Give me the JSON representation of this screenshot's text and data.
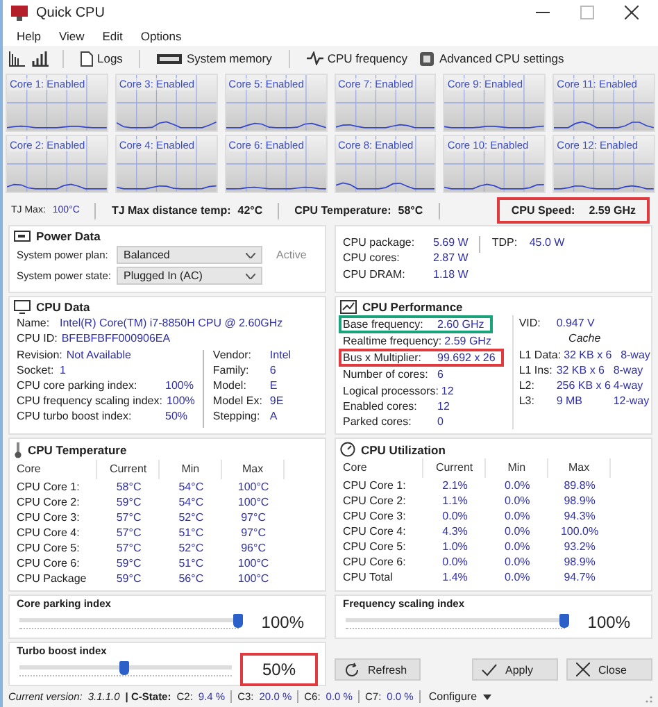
{
  "window": {
    "title": "Quick CPU"
  },
  "menu": [
    "Help",
    "View",
    "Edit",
    "Options"
  ],
  "toolbar": [
    "Logs",
    "System memory",
    "CPU frequency",
    "Advanced CPU settings"
  ],
  "cores": [
    {
      "label": "Core 1: Enabled"
    },
    {
      "label": "Core 3: Enabled"
    },
    {
      "label": "Core 5: Enabled"
    },
    {
      "label": "Core 7: Enabled"
    },
    {
      "label": "Core 9: Enabled"
    },
    {
      "label": "Core 11: Enabled"
    },
    {
      "label": "Core 2: Enabled"
    },
    {
      "label": "Core 4: Enabled"
    },
    {
      "label": "Core 6: Enabled"
    },
    {
      "label": "Core 8: Enabled"
    },
    {
      "label": "Core 10: Enabled"
    },
    {
      "label": "Core 12: Enabled"
    }
  ],
  "summary": {
    "tj_max_label": "TJ Max:",
    "tj_max": "100°C",
    "distance_label": "TJ Max distance temp:",
    "distance": "42°C",
    "temp_label": "CPU Temperature:",
    "temp": "58°C",
    "speed_label": "CPU Speed:",
    "speed": "2.59 GHz",
    "speed_highlighted": true
  },
  "power_data": {
    "title": "Power Data",
    "plan_label": "System power plan:",
    "plan": "Balanced",
    "plan_status": "Active",
    "state_label": "System power state:",
    "state": "Plugged In (AC)"
  },
  "power_readings": {
    "rows": [
      {
        "label": "CPU package:",
        "value": "5.69 W"
      },
      {
        "label": "CPU cores:",
        "value": "2.87 W"
      },
      {
        "label": "CPU DRAM:",
        "value": "1.18 W"
      }
    ],
    "tdp_label": "TDP:",
    "tdp": "45.0 W"
  },
  "cpu_data": {
    "title": "CPU Data",
    "name_label": "Name:",
    "name": "Intel(R) Core(TM) i7-8850H CPU @ 2.60GHz",
    "id_label": "CPU ID:",
    "id": "BFEBFBFF000906EA",
    "left": [
      {
        "label": "Revision:",
        "value": "Not Available"
      },
      {
        "label": "Socket:",
        "value": "1"
      },
      {
        "label": "CPU core parking index:",
        "value": "100%"
      },
      {
        "label": "CPU frequency scaling index:",
        "value": "100%"
      },
      {
        "label": "CPU turbo boost index:",
        "value": "50%"
      }
    ],
    "right": [
      {
        "label": "Vendor:",
        "value": "Intel"
      },
      {
        "label": "Family:",
        "value": "6"
      },
      {
        "label": "Model:",
        "value": "E"
      },
      {
        "label": "Model Ex:",
        "value": "9E"
      },
      {
        "label": "Stepping:",
        "value": "A"
      }
    ]
  },
  "cpu_performance": {
    "title": "CPU Performance",
    "rows": [
      {
        "label": "Base frequency:",
        "value": "2.60 GHz",
        "highlighted": true,
        "color": "#1aa37a"
      },
      {
        "label": "Realtime frequency:",
        "value": "2.59 GHz"
      },
      {
        "label": "Bus x Multiplier:",
        "value": "99.692 x 26",
        "highlighted": true,
        "color": "#e0393e"
      },
      {
        "label": "Number of cores:",
        "value": "6"
      },
      {
        "label": "Logical processors:",
        "value": "12"
      },
      {
        "label": "Enabled cores:",
        "value": "12"
      },
      {
        "label": "Parked cores:",
        "value": "0"
      }
    ],
    "vid_label": "VID:",
    "vid": "0.947 V",
    "cache_title": "Cache",
    "cache": [
      {
        "label": "L1 Data:",
        "size": "32 KB x 6",
        "ways": "8-way"
      },
      {
        "label": "L1 Ins:",
        "size": "32 KB x 6",
        "ways": "8-way"
      },
      {
        "label": "L2:",
        "size": "256 KB x 6",
        "ways": "4-way"
      },
      {
        "label": "L3:",
        "size": "9 MB",
        "ways": "12-way"
      }
    ]
  },
  "tables": [
    {
      "kind": "temperature",
      "title": "CPU Temperature",
      "columns": [
        "Core",
        "Current",
        "Min",
        "Max"
      ],
      "rows": [
        [
          "CPU Core 1:",
          "58°C",
          "54°C",
          "100°C"
        ],
        [
          "CPU Core 2:",
          "59°C",
          "54°C",
          "100°C"
        ],
        [
          "CPU Core 3:",
          "57°C",
          "52°C",
          "97°C"
        ],
        [
          "CPU Core 4:",
          "57°C",
          "51°C",
          "97°C"
        ],
        [
          "CPU Core 5:",
          "57°C",
          "52°C",
          "96°C"
        ],
        [
          "CPU Core 6:",
          "59°C",
          "51°C",
          "100°C"
        ],
        [
          "CPU Package",
          "59°C",
          "56°C",
          "100°C"
        ]
      ]
    },
    {
      "kind": "utilization",
      "title": "CPU Utilization",
      "columns": [
        "Core",
        "Current",
        "Min",
        "Max"
      ],
      "rows": [
        [
          "CPU Core 1:",
          "2.1%",
          "0.0%",
          "89.8%"
        ],
        [
          "CPU Core 2:",
          "1.1%",
          "0.0%",
          "98.9%"
        ],
        [
          "CPU Core 3:",
          "0.0%",
          "0.0%",
          "94.3%"
        ],
        [
          "CPU Core 4:",
          "4.3%",
          "0.0%",
          "100.0%"
        ],
        [
          "CPU Core 5:",
          "1.0%",
          "0.0%",
          "93.2%"
        ],
        [
          "CPU Core 6:",
          "0.0%",
          "0.0%",
          "98.9%"
        ],
        [
          "CPU Total",
          "1.4%",
          "0.0%",
          "94.7%"
        ]
      ]
    }
  ],
  "sliders": [
    {
      "title": "Core parking index",
      "level": 1,
      "reading": "100%"
    },
    {
      "title": "Frequency scaling index",
      "level": 1,
      "reading": "100%"
    },
    {
      "title": "Turbo boost index",
      "level": 0.5,
      "reading": "50%",
      "highlighted": true
    }
  ],
  "buttons": [
    {
      "kind": "refresh",
      "label": "Refresh"
    },
    {
      "kind": "apply",
      "label": "Apply"
    },
    {
      "kind": "close",
      "label": "Close"
    }
  ],
  "status_bar": {
    "version_label": "Current version:",
    "version": "3.1.1.0",
    "cstate_label": "| C-State:",
    "cstates": [
      {
        "label": "C2:",
        "value": "9.4 %"
      },
      {
        "label": "C3:",
        "value": "20.0 %"
      },
      {
        "label": "C6:",
        "value": "0.0 %"
      },
      {
        "label": "C7:",
        "value": "0.0 %"
      }
    ],
    "configure": "Configure"
  }
}
